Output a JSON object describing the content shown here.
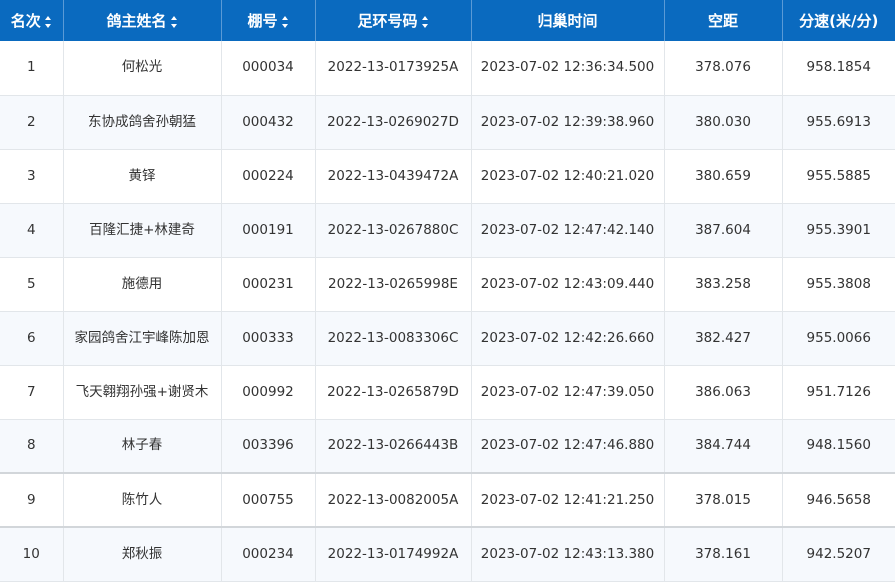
{
  "table": {
    "headers": [
      {
        "label": "名次",
        "sortable": true
      },
      {
        "label": "鸽主姓名",
        "sortable": true
      },
      {
        "label": "棚号",
        "sortable": true
      },
      {
        "label": "足环号码",
        "sortable": true
      },
      {
        "label": "归巢时间",
        "sortable": false
      },
      {
        "label": "空距",
        "sortable": false
      },
      {
        "label": "分速(米/分)",
        "sortable": false
      }
    ],
    "rows": [
      [
        "1",
        "何松光",
        "000034",
        "2022-13-0173925A",
        "2023-07-02 12:36:34.500",
        "378.076",
        "958.1854"
      ],
      [
        "2",
        "东协成鸽舍孙朝猛",
        "000432",
        "2022-13-0269027D",
        "2023-07-02 12:39:38.960",
        "380.030",
        "955.6913"
      ],
      [
        "3",
        "黄铎",
        "000224",
        "2022-13-0439472A",
        "2023-07-02 12:40:21.020",
        "380.659",
        "955.5885"
      ],
      [
        "4",
        "百隆汇捷+林建奇",
        "000191",
        "2022-13-0267880C",
        "2023-07-02 12:47:42.140",
        "387.604",
        "955.3901"
      ],
      [
        "5",
        "施德用",
        "000231",
        "2022-13-0265998E",
        "2023-07-02 12:43:09.440",
        "383.258",
        "955.3808"
      ],
      [
        "6",
        "家园鸽舍江宇峰陈加恩",
        "000333",
        "2022-13-0083306C",
        "2023-07-02 12:42:26.660",
        "382.427",
        "955.0066"
      ],
      [
        "7",
        "飞天翱翔孙强+谢贤木",
        "000992",
        "2022-13-0265879D",
        "2023-07-02 12:47:39.050",
        "386.063",
        "951.7126"
      ],
      [
        "8",
        "林子春",
        "003396",
        "2022-13-0266443B",
        "2023-07-02 12:47:46.880",
        "384.744",
        "948.1560"
      ],
      [
        "9",
        "陈竹人",
        "000755",
        "2022-13-0082005A",
        "2023-07-02 12:41:21.250",
        "378.015",
        "946.5658"
      ],
      [
        "10",
        "郑秋振",
        "000234",
        "2022-13-0174992A",
        "2023-07-02 12:43:13.380",
        "378.161",
        "942.5207"
      ]
    ]
  }
}
